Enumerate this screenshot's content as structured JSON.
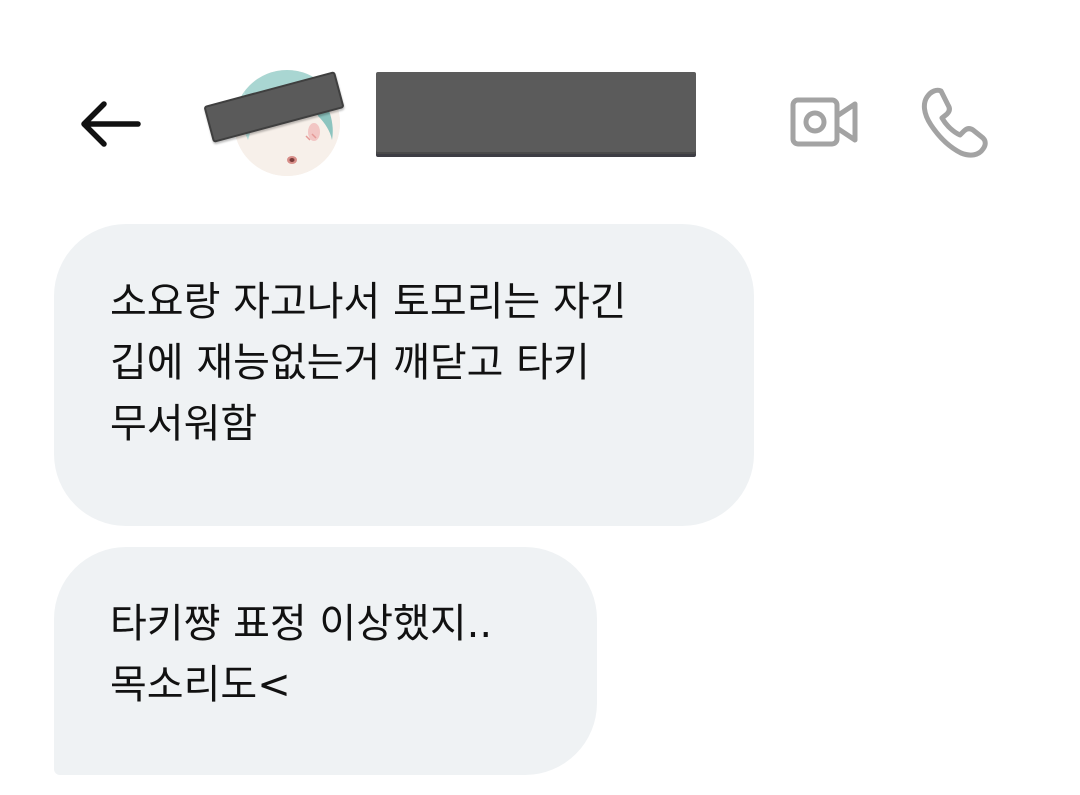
{
  "header": {
    "back_icon": "arrow-left-icon",
    "video_icon": "video-camera-icon",
    "call_icon": "phone-icon",
    "icon_color": "#a3a3a3",
    "back_color": "#111111"
  },
  "messages": [
    {
      "lines": [
        "소요랑 자고나서 토모리는 자긴",
        "깁에 재능없는거 깨닫고 타키",
        "무서워함"
      ]
    },
    {
      "lines": [
        "타키쨩 표정 이상했지..",
        "목소리도<"
      ]
    }
  ],
  "colors": {
    "bubble_bg": "#eff2f4",
    "redaction": "#5b5b5b"
  }
}
